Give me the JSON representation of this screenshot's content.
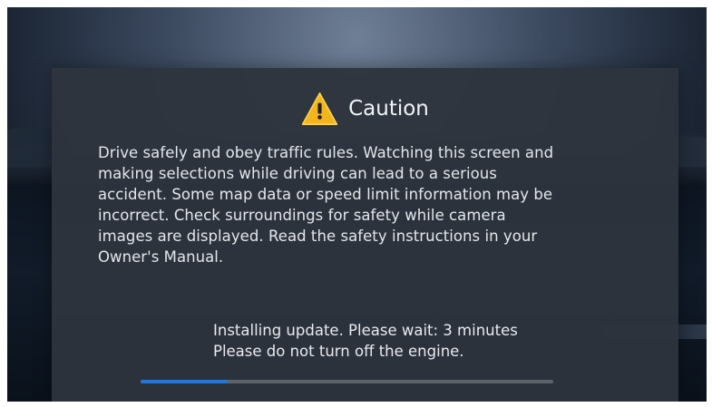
{
  "dialog": {
    "icon": "warning-triangle-icon",
    "title": "Caution",
    "message_lines": [
      "Drive safely and obey traffic rules. Watching this screen and",
      "making selections while driving can lead to a serious",
      "accident. Some map data or speed limit information may be",
      "incorrect. Check surroundings for safety while camera",
      "images are displayed. Read the safety instructions in your",
      "Owner's Manual."
    ],
    "status_line_1": "Installing update. Please wait: 3 minutes",
    "status_line_2": "Please do not turn off the engine.",
    "progress": 0.21
  },
  "colors": {
    "accent": "#1e78df",
    "warning": "#f2b51b",
    "panel": "#2e343d"
  }
}
